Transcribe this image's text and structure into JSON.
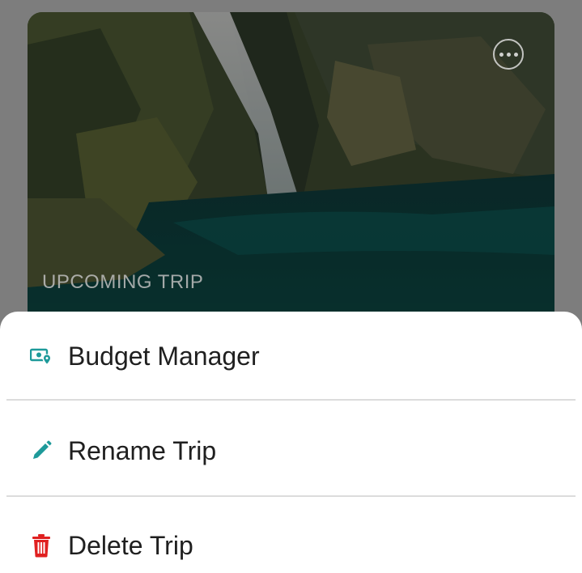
{
  "trip_card": {
    "status": "UPCOMING TRIP",
    "more_icon": "more-horizontal-icon"
  },
  "menu": {
    "items": [
      {
        "label": "Budget Manager",
        "icon": "budget-icon",
        "color": "#1e9a9a"
      },
      {
        "label": "Rename Trip",
        "icon": "pencil-icon",
        "color": "#1e9a9a"
      },
      {
        "label": "Delete Trip",
        "icon": "trash-icon",
        "color": "#e02020"
      }
    ]
  }
}
